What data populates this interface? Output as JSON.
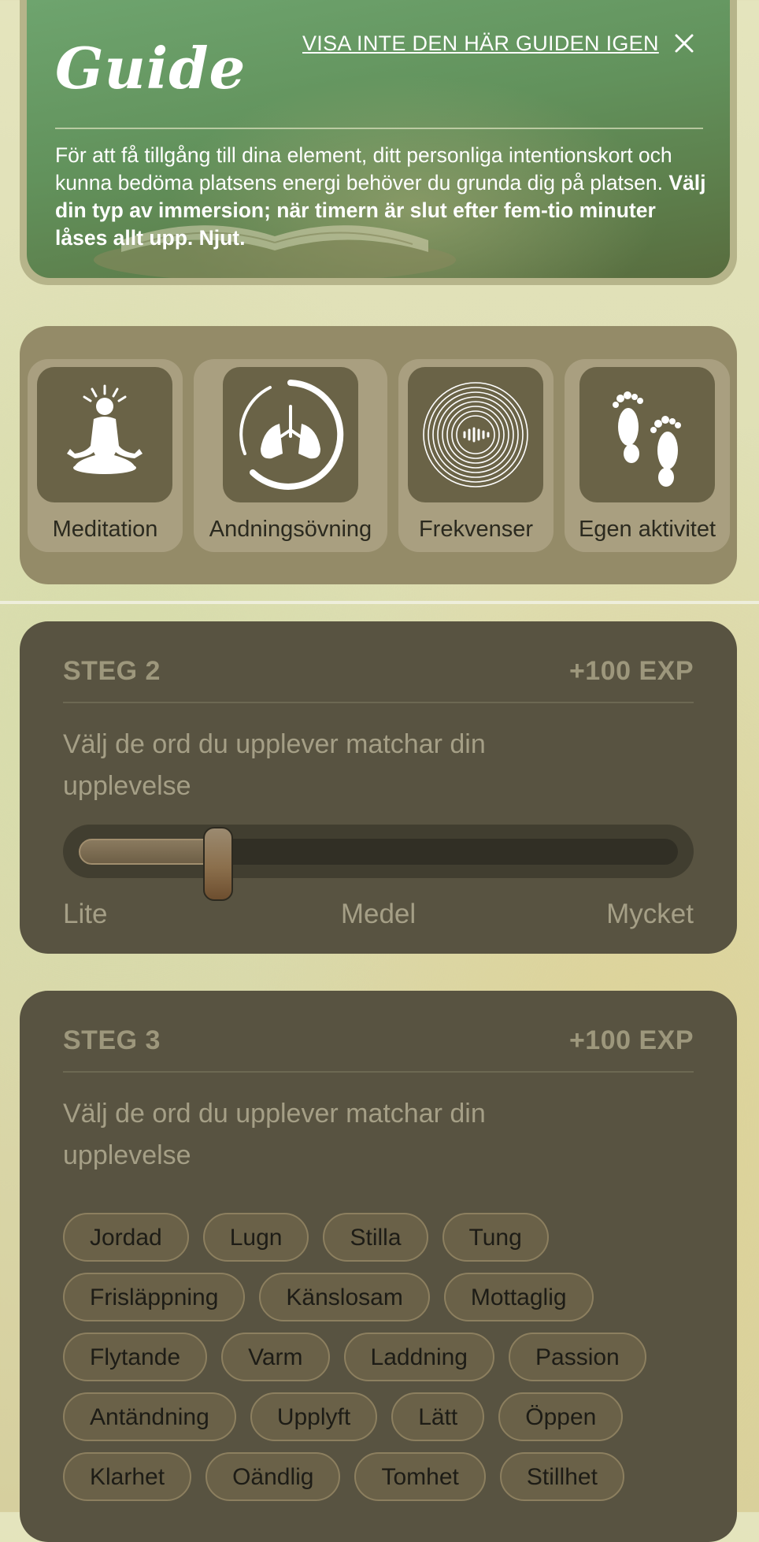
{
  "guide": {
    "title": "Guide",
    "hide_link": "VISA INTE DEN HÄR GUIDEN IGEN",
    "close_icon": "close-icon",
    "text_regular": "För att få tillgång till dina element, ditt personliga intentionskort och kunna bedöma platsens energi behöver du grunda dig på platsen. ",
    "text_bold": "Välj din typ av immersion; när timern är slut efter fem-tio minuter låses allt upp. Njut."
  },
  "immersion": {
    "options": [
      {
        "label": "Meditation",
        "icon": "meditation-icon"
      },
      {
        "label": "Andningsövning",
        "icon": "lungs-icon"
      },
      {
        "label": "Frekvenser",
        "icon": "sound-wave-icon"
      },
      {
        "label": "Egen aktivitet",
        "icon": "footprints-icon"
      }
    ]
  },
  "step2": {
    "label": "STEG 2",
    "exp": "+100 EXP",
    "question": "Välj de ord du upplever matchar din upplevelse",
    "slider": {
      "value": 0.2,
      "min_label": "Lite",
      "mid_label": "Medel",
      "max_label": "Mycket"
    }
  },
  "step3": {
    "label": "STEG 3",
    "exp": "+100 EXP",
    "question": "Välj de ord du upplever matchar din upplevelse",
    "word_rows": [
      [
        "Jordad",
        "Lugn",
        "Stilla",
        "Tung"
      ],
      [
        "Frisläppning",
        "Känslosam",
        "Mottaglig"
      ],
      [
        "Flytande",
        "Varm",
        "Laddning",
        "Passion"
      ],
      [
        "Antändning",
        "Upplyft",
        "Lätt",
        "Öppen"
      ],
      [
        "Klarhet",
        "Oändlig",
        "Tomhet",
        "Stillhet"
      ]
    ]
  },
  "colors": {
    "guide_green": "#62925c",
    "panel": "#948b68",
    "step_card": "#585341",
    "chip": "#6a6148"
  }
}
